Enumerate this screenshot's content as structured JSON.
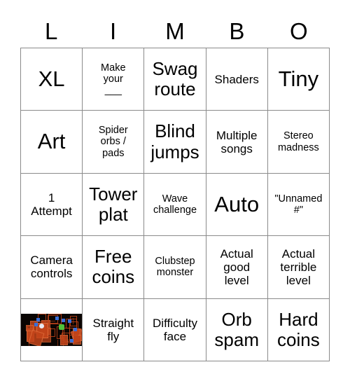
{
  "header": {
    "letters": [
      "L",
      "I",
      "M",
      "B",
      "O"
    ]
  },
  "grid": {
    "rows": [
      [
        {
          "text": "XL",
          "size": "fs-xxl",
          "type": "text"
        },
        {
          "text": "Make\nyour\n___",
          "size": "fs-sm",
          "type": "text"
        },
        {
          "text": "Swag\nroute",
          "size": "fs-xl",
          "type": "text"
        },
        {
          "text": "Shaders",
          "size": "fs-md",
          "type": "text"
        },
        {
          "text": "Tiny",
          "size": "fs-xxl",
          "type": "text"
        }
      ],
      [
        {
          "text": "Art",
          "size": "fs-xxl",
          "type": "text"
        },
        {
          "text": "Spider\norbs /\npads",
          "size": "fs-sm",
          "type": "text"
        },
        {
          "text": "Blind\njumps",
          "size": "fs-xl",
          "type": "text"
        },
        {
          "text": "Multiple\nsongs",
          "size": "fs-md",
          "type": "text"
        },
        {
          "text": "Stereo\nmadness",
          "size": "fs-sm",
          "type": "text"
        }
      ],
      [
        {
          "text": "1\nAttempt",
          "size": "fs-md",
          "type": "text"
        },
        {
          "text": "Tower\nplat",
          "size": "fs-xl",
          "type": "text"
        },
        {
          "text": "Wave\nchallenge",
          "size": "fs-sm",
          "type": "text"
        },
        {
          "text": "Auto",
          "size": "fs-xxl",
          "type": "text"
        },
        {
          "text": "\"Unnamed\n#\"",
          "size": "fs-sm",
          "type": "text"
        }
      ],
      [
        {
          "text": "Camera\ncontrols",
          "size": "fs-md",
          "type": "text"
        },
        {
          "text": "Free\ncoins",
          "size": "fs-xl",
          "type": "text"
        },
        {
          "text": "Clubstep\nmonster",
          "size": "fs-sm",
          "type": "text"
        },
        {
          "text": "Actual\ngood\nlevel",
          "size": "fs-md",
          "type": "text"
        },
        {
          "text": "Actual\nterrible\nlevel",
          "size": "fs-md",
          "type": "text"
        }
      ],
      [
        {
          "text": "",
          "size": "fs-sm",
          "type": "image",
          "image_name": "geometry-dash-level-thumbnail"
        },
        {
          "text": "Straight\nfly",
          "size": "fs-md",
          "type": "text"
        },
        {
          "text": "Difficulty\nface",
          "size": "fs-md",
          "type": "text"
        },
        {
          "text": "Orb\nspam",
          "size": "fs-xl",
          "type": "text"
        },
        {
          "text": "Hard\ncoins",
          "size": "fs-xl",
          "type": "text"
        }
      ]
    ]
  },
  "colors": {
    "page_background": "#ffffff",
    "cell_background": "#ffffff",
    "grid_line": "#8a8a8a",
    "text": "#000000",
    "thumb_background": "#0a0503",
    "thumb_block": "#c2441a",
    "thumb_block_light": "#e06a38",
    "thumb_accent_blue": "#3a6fd8",
    "thumb_accent_green": "#4fc23a",
    "thumb_accent_white": "#e8e8f0"
  }
}
